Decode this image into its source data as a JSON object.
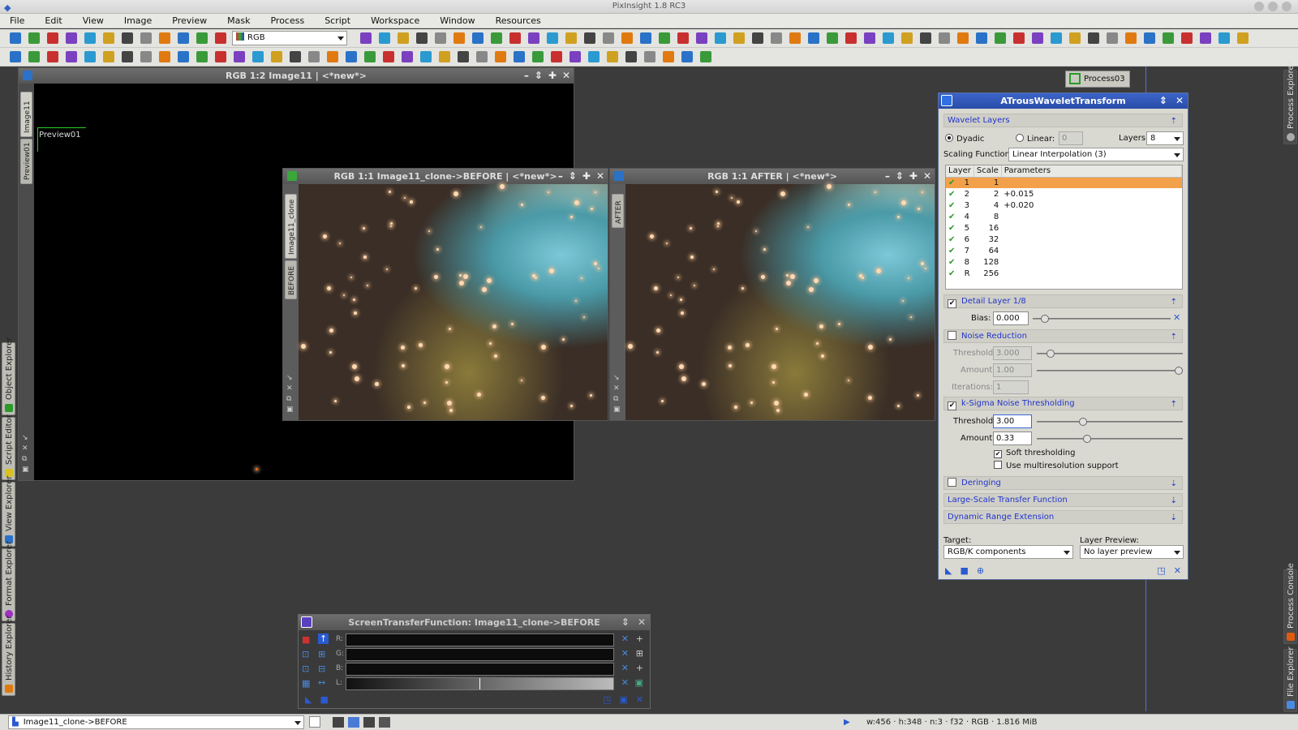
{
  "app": {
    "title": "PixInsight 1.8 RC3"
  },
  "menu": [
    "File",
    "Edit",
    "View",
    "Image",
    "Preview",
    "Mask",
    "Process",
    "Script",
    "Workspace",
    "Window",
    "Resources"
  ],
  "toolbar": {
    "rgb_combo": "RGB"
  },
  "left_dock": [
    "Object Explorer",
    "Script Editor",
    "View Explorer",
    "Format Explorer",
    "History Explorer"
  ],
  "right_dock": [
    "Process Explorer",
    "Process Console",
    "File Explorer"
  ],
  "windows": {
    "image11": {
      "title": "RGB 1:2 Image11 | <*new*>",
      "tabs": [
        "Image11",
        "Preview01"
      ],
      "preview_label": "Preview01"
    },
    "before": {
      "title": "RGB 1:1 Image11_clone->BEFORE | <*new*>",
      "tabs": [
        "Image11_clone",
        "BEFORE"
      ]
    },
    "after": {
      "title": "RGB 1:1 AFTER | <*new*>",
      "tabs": [
        "AFTER"
      ]
    }
  },
  "process_icon": {
    "label": "Process03"
  },
  "atrous": {
    "title": "ATrousWaveletTransform",
    "wavelet_layers": "Wavelet Layers",
    "dyadic": "Dyadic",
    "linear": "Linear:",
    "linear_value": "0",
    "layers_label": "Layers:",
    "layers_value": "8",
    "scaling_label": "Scaling Function:",
    "scaling_value": "Linear Interpolation (3)",
    "table_headers": [
      "Layer",
      "Scale",
      "Parameters"
    ],
    "rows": [
      {
        "layer": "1",
        "scale": "1",
        "param": ""
      },
      {
        "layer": "2",
        "scale": "2",
        "param": "+0.015"
      },
      {
        "layer": "3",
        "scale": "4",
        "param": "+0.020"
      },
      {
        "layer": "4",
        "scale": "8",
        "param": ""
      },
      {
        "layer": "5",
        "scale": "16",
        "param": ""
      },
      {
        "layer": "6",
        "scale": "32",
        "param": ""
      },
      {
        "layer": "7",
        "scale": "64",
        "param": ""
      },
      {
        "layer": "8",
        "scale": "128",
        "param": ""
      },
      {
        "layer": "R",
        "scale": "256",
        "param": ""
      }
    ],
    "detail_layer": "Detail Layer 1/8",
    "bias_label": "Bias:",
    "bias_value": "0.000",
    "noise_reduction": "Noise Reduction",
    "nr_threshold_label": "Threshold:",
    "nr_threshold": "3.000",
    "nr_amount_label": "Amount:",
    "nr_amount": "1.00",
    "nr_iterations_label": "Iterations:",
    "nr_iterations": "1",
    "ksigma": "k-Sigma Noise Thresholding",
    "ks_threshold_label": "Threshold:",
    "ks_threshold": "3.00",
    "ks_amount_label": "Amount:",
    "ks_amount": "0.33",
    "soft_thresholding": "Soft thresholding",
    "multires": "Use multiresolution support",
    "deringing": "Deringing",
    "lstf": "Large-Scale Transfer Function",
    "dre": "Dynamic Range Extension",
    "target_label": "Target:",
    "target_value": "RGB/K components",
    "layer_preview_label": "Layer Preview:",
    "layer_preview_value": "No layer preview"
  },
  "stf": {
    "title": "ScreenTransferFunction: Image11_clone->BEFORE",
    "channels": [
      "R:",
      "G:",
      "B:",
      "L:"
    ]
  },
  "statusbar": {
    "view": "Image11_clone->BEFORE",
    "info": "w:456  ·  h:348  ·  n:3  ·  f32  ·  RGB  ·  1.816 MiB"
  }
}
